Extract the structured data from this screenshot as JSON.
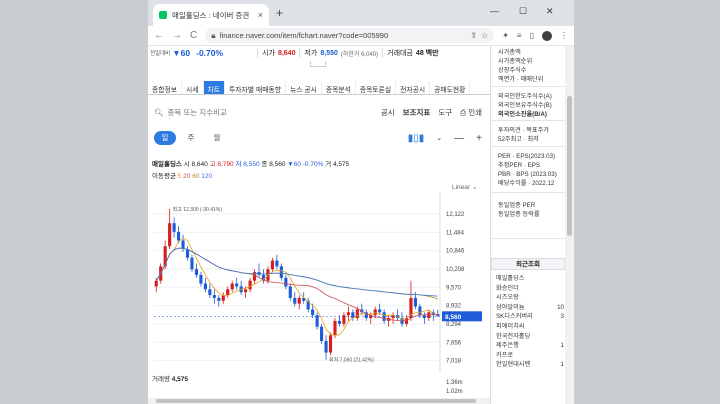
{
  "browser": {
    "tab_title": "매일홀딩스 : 네이버 증권",
    "tab_close": "×",
    "new_tab": "+",
    "url": "finance.naver.com/item/fchart.naver?code=005990",
    "back": "←",
    "forward": "→",
    "reload": "C",
    "minimize": "—",
    "maximize": "☐",
    "close": "✕"
  },
  "quote_bar": {
    "prev_label": "전일대비",
    "change": "▼60",
    "change_pct": "-0.70%",
    "open_label": "시가",
    "open": "8,640",
    "low_label": "저가",
    "low": "8,550",
    "low_limit": "(하한가 6,040)",
    "volume_label": "거래대금",
    "volume": "48 백만"
  },
  "tabs": [
    "종합정보",
    "시세",
    "차트",
    "투자자별 매매동향",
    "뉴스 공시",
    "종목분석",
    "종목토론실",
    "전자공시",
    "공매도현황"
  ],
  "active_tab": "차트",
  "search": {
    "placeholder": "종목 또는 지수비교",
    "notice": "공시",
    "indicator": "보조지표",
    "tools": "도구",
    "print": "인쇄"
  },
  "periods": [
    "일",
    "주",
    "월"
  ],
  "ohlc": {
    "name": "매일홀딩스",
    "o_label": "시",
    "o": "8,640",
    "h_label": "고",
    "h": "8,790",
    "l_label": "저",
    "l": "8,550",
    "c_label": "종",
    "c": "8,560",
    "chg": "▼60",
    "pct": "-0.70%",
    "v_label": "거",
    "v": "4,575"
  },
  "moving_avg": {
    "label": "이동평균",
    "p5": "5",
    "p20": "20",
    "p60": "60",
    "p120": "120"
  },
  "scale_mode": "Linear",
  "chart_data": {
    "type": "candlestick",
    "title": "",
    "price_ticks": [
      "12,122",
      "11,484",
      "10,846",
      "10,208",
      "9,570",
      "8,932",
      "8,294",
      "7,656",
      "7,018"
    ],
    "current_price": "8,560",
    "high_annotation": "최고 12,300 (-30.41%)",
    "low_annotation": "최저 7,050 (21.42%)",
    "ylim": [
      6900,
      12400
    ],
    "ohlc": [
      [
        9600,
        9900,
        9400,
        9800
      ],
      [
        9800,
        10400,
        9700,
        10300
      ],
      [
        10300,
        11200,
        10200,
        11000
      ],
      [
        11000,
        12300,
        10900,
        11800
      ],
      [
        11800,
        12000,
        11300,
        11500
      ],
      [
        11500,
        11700,
        11100,
        11200
      ],
      [
        11200,
        11400,
        10800,
        10900
      ],
      [
        10900,
        11000,
        10500,
        10600
      ],
      [
        10600,
        10700,
        10100,
        10200
      ],
      [
        10200,
        10400,
        9900,
        10000
      ],
      [
        10000,
        10100,
        9600,
        9700
      ],
      [
        9700,
        9900,
        9400,
        9500
      ],
      [
        9500,
        9700,
        9200,
        9300
      ],
      [
        9300,
        9500,
        9000,
        9200
      ],
      [
        9200,
        9300,
        8900,
        9100
      ],
      [
        9100,
        9400,
        9000,
        9300
      ],
      [
        9300,
        9600,
        9200,
        9500
      ],
      [
        9500,
        9800,
        9400,
        9700
      ],
      [
        9700,
        9900,
        9500,
        9600
      ],
      [
        9600,
        9800,
        9300,
        9400
      ],
      [
        9400,
        9600,
        9200,
        9500
      ],
      [
        9500,
        9900,
        9400,
        9800
      ],
      [
        9800,
        10200,
        9700,
        10100
      ],
      [
        10100,
        10400,
        9900,
        10000
      ],
      [
        10000,
        10200,
        9700,
        9800
      ],
      [
        9800,
        10300,
        9700,
        10200
      ],
      [
        10200,
        10600,
        10100,
        10500
      ],
      [
        10500,
        10700,
        10200,
        10300
      ],
      [
        10300,
        10400,
        9800,
        9900
      ],
      [
        9900,
        10000,
        9500,
        9600
      ],
      [
        9600,
        9700,
        9100,
        9200
      ],
      [
        9200,
        9400,
        8900,
        9000
      ],
      [
        9000,
        9300,
        8800,
        9200
      ],
      [
        9200,
        9400,
        9000,
        9100
      ],
      [
        9100,
        9200,
        8700,
        8800
      ],
      [
        8800,
        9000,
        8500,
        8600
      ],
      [
        8600,
        8700,
        8100,
        8200
      ],
      [
        8200,
        8300,
        7600,
        7700
      ],
      [
        7700,
        7900,
        7050,
        7300
      ],
      [
        7300,
        8000,
        7200,
        7900
      ],
      [
        7900,
        8500,
        7800,
        8400
      ],
      [
        8400,
        8600,
        8200,
        8300
      ],
      [
        8300,
        8700,
        8200,
        8600
      ],
      [
        8600,
        8900,
        8400,
        8700
      ],
      [
        8700,
        8800,
        8400,
        8500
      ],
      [
        8500,
        8900,
        8400,
        8800
      ],
      [
        8800,
        9000,
        8600,
        8700
      ],
      [
        8700,
        8800,
        8400,
        8500
      ],
      [
        8500,
        8700,
        8300,
        8600
      ],
      [
        8600,
        8900,
        8500,
        8800
      ],
      [
        8800,
        9000,
        8600,
        8700
      ],
      [
        8700,
        8800,
        8300,
        8400
      ],
      [
        8400,
        8600,
        8200,
        8500
      ],
      [
        8500,
        8700,
        8300,
        8600
      ],
      [
        8600,
        8800,
        8400,
        8500
      ],
      [
        8500,
        8700,
        8200,
        8300
      ],
      [
        8300,
        8600,
        8200,
        8500
      ],
      [
        8500,
        9800,
        8400,
        9200
      ],
      [
        9200,
        9400,
        8800,
        8900
      ],
      [
        8900,
        9000,
        8500,
        8600
      ],
      [
        8600,
        8700,
        8300,
        8500
      ],
      [
        8500,
        8800,
        8400,
        8700
      ],
      [
        8700,
        8800,
        8400,
        8600
      ],
      [
        8640,
        8790,
        8550,
        8560
      ]
    ],
    "volume_ticks": [
      "1.36m",
      "1.02m"
    ],
    "volume_label": "거래량",
    "volume": "4,575"
  },
  "right_panel": {
    "block1": [
      "시가총액",
      "시가총액순위",
      "상장주식수",
      "액면가 · 매매단위"
    ],
    "block2": [
      "외국인한도주식수(A)",
      "외국인보유주식수(B)",
      "외국인소진율(B/A)"
    ],
    "block3": [
      "투자의견 · 목표주가",
      "52주최고 · 최저"
    ],
    "block4": [
      "PER · EPS(2023.03)",
      "추정PER · EPS",
      "PBR · BPS (2023.03)",
      "배당수익률 · 2022.12"
    ],
    "block5": [
      "동일업종 PER",
      "동일업종 등락률"
    ],
    "recent_title": "최근조회",
    "recent": [
      {
        "name": "매일홀딩스",
        "val": ""
      },
      {
        "name": "화승인더",
        "val": ""
      },
      {
        "name": "시즈오랑",
        "val": ""
      },
      {
        "name": "삼아알미늄",
        "val": "10"
      },
      {
        "name": "SK디스커버리",
        "val": "3"
      },
      {
        "name": "",
        "val": ""
      },
      {
        "name": "피에이치씨",
        "val": ""
      },
      {
        "name": "한국전자홀딩",
        "val": ""
      },
      {
        "name": "제주은행",
        "val": "1"
      },
      {
        "name": "카프로",
        "val": ""
      },
      {
        "name": "한일현대시멘",
        "val": "1"
      }
    ]
  },
  "colors": {
    "accent": "#2d7be0",
    "up": "#d81b1b",
    "down": "#1e5bd7"
  }
}
